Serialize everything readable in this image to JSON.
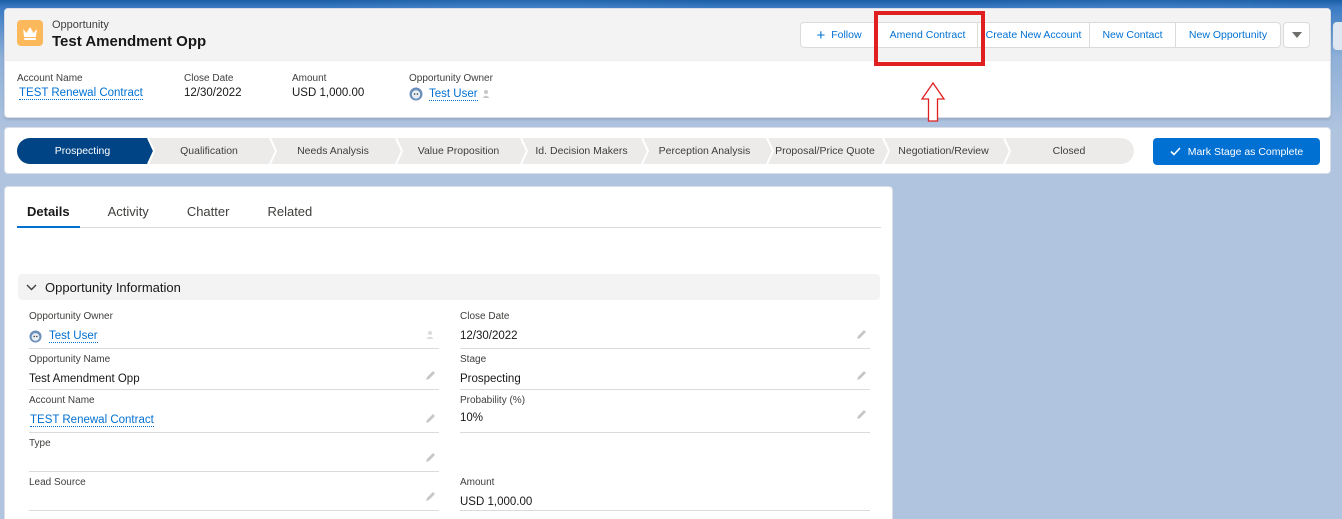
{
  "header": {
    "object_type": "Opportunity",
    "record_name": "Test Amendment Opp",
    "actions": {
      "follow": "Follow",
      "amend_contract": "Amend Contract",
      "create_new_account": "Create New Account",
      "new_contact": "New Contact",
      "new_opportunity": "New Opportunity"
    },
    "highlights": {
      "account_name": {
        "label": "Account Name",
        "value": "TEST Renewal Contract"
      },
      "close_date": {
        "label": "Close Date",
        "value": "12/30/2022"
      },
      "amount": {
        "label": "Amount",
        "value": "USD 1,000.00"
      },
      "owner": {
        "label": "Opportunity Owner",
        "value": "Test User"
      }
    }
  },
  "path": {
    "stages": [
      "Prospecting",
      "Qualification",
      "Needs Analysis",
      "Value Proposition",
      "Id. Decision Makers",
      "Perception Analysis",
      "Proposal/Price Quote",
      "Negotiation/Review",
      "Closed"
    ],
    "active_stage": "Prospecting",
    "mark_complete": "Mark Stage as Complete"
  },
  "tabs": [
    "Details",
    "Activity",
    "Chatter",
    "Related"
  ],
  "section": {
    "title": "Opportunity Information",
    "fields": {
      "owner": {
        "label": "Opportunity Owner",
        "value": "Test User"
      },
      "close_date": {
        "label": "Close Date",
        "value": "12/30/2022"
      },
      "name": {
        "label": "Opportunity Name",
        "value": "Test Amendment Opp"
      },
      "stage": {
        "label": "Stage",
        "value": "Prospecting"
      },
      "account": {
        "label": "Account Name",
        "value": "TEST Renewal Contract"
      },
      "probability": {
        "label": "Probability (%)",
        "value": "10%"
      },
      "type": {
        "label": "Type",
        "value": ""
      },
      "lead_source": {
        "label": "Lead Source",
        "value": ""
      },
      "amount": {
        "label": "Amount",
        "value": "USD 1,000.00"
      }
    }
  },
  "colors": {
    "brand": "#0070d2",
    "active_stage": "#014486",
    "highlight": "#e02020",
    "object_icon": "#fcb95b"
  },
  "icons": {
    "object": "crown-icon",
    "owner": "user-avatar-icon",
    "edit": "pencil-icon"
  }
}
